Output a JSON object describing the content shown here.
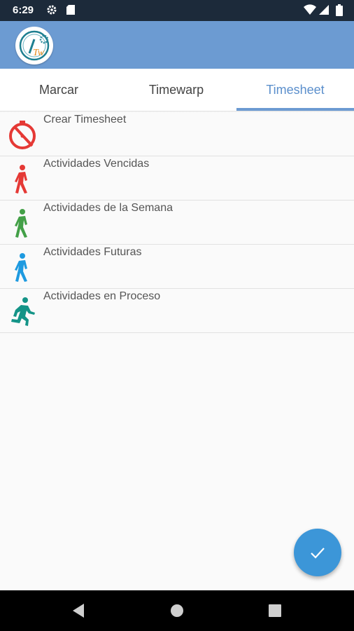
{
  "status": {
    "time": "6:29"
  },
  "tabs": [
    {
      "label": "Marcar",
      "active": false
    },
    {
      "label": "Timewarp",
      "active": false
    },
    {
      "label": "Timesheet",
      "active": true
    }
  ],
  "list": [
    {
      "label": "Crear Timesheet",
      "icon": "timer-off-icon",
      "color": "#e53935"
    },
    {
      "label": "Actividades Vencidas",
      "icon": "walking-person-icon",
      "color": "#e53935"
    },
    {
      "label": "Actividades de la Semana",
      "icon": "walking-person-icon",
      "color": "#43a047"
    },
    {
      "label": "Actividades Futuras",
      "icon": "walking-person-icon",
      "color": "#1e9ae0"
    },
    {
      "label": "Actividades en Proceso",
      "icon": "running-person-icon",
      "color": "#149487"
    }
  ],
  "colors": {
    "accent": "#6c9bd2",
    "fab": "#3c96d8",
    "statusbar": "#1c2a3a"
  }
}
